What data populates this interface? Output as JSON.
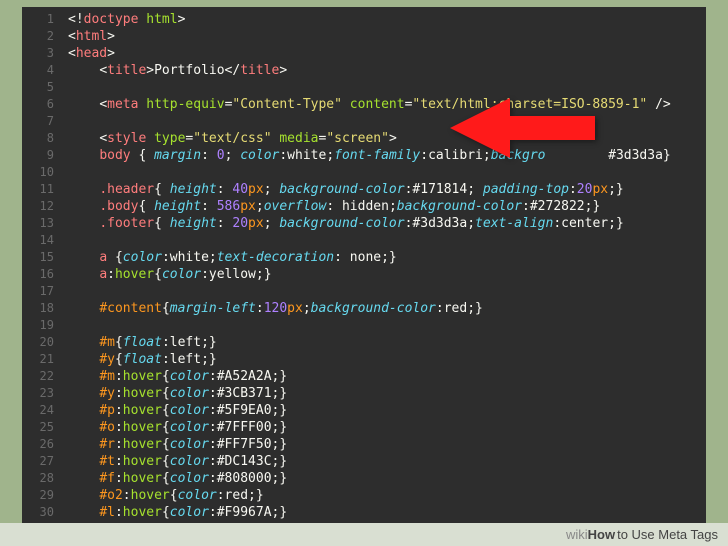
{
  "footer": {
    "wiki": "wiki",
    "how": "How",
    "title": " to Use Meta Tags"
  },
  "lines": [
    {
      "n": "1",
      "html": "<span class='w'>&lt;!</span><span class='t'>doctype</span> <span class='a'>html</span><span class='w'>&gt;</span>"
    },
    {
      "n": "2",
      "html": "<span class='w'>&lt;</span><span class='t'>html</span><span class='w'>&gt;</span>"
    },
    {
      "n": "3",
      "html": "<span class='w'>&lt;</span><span class='t'>head</span><span class='w'>&gt;</span>"
    },
    {
      "n": "4",
      "html": "    <span class='w'>&lt;</span><span class='t'>title</span><span class='w'>&gt;Portfolio&lt;/</span><span class='t'>title</span><span class='w'>&gt;</span>"
    },
    {
      "n": "5",
      "html": ""
    },
    {
      "n": "6",
      "html": "    <span class='w'>&lt;</span><span class='t'>meta</span> <span class='a'>http-equiv</span><span class='w'>=</span><span class='s'>\"Content-Type\"</span> <span class='a'>content</span><span class='w'>=</span><span class='s'>\"text/html;charset=ISO-8859-1\"</span> <span class='w'>/&gt;</span>",
      "hl": true
    },
    {
      "n": "7",
      "html": ""
    },
    {
      "n": "8",
      "html": "    <span class='w'>&lt;</span><span class='t'>style</span> <span class='a'>type</span><span class='w'>=</span><span class='s'>\"text/css\"</span> <span class='a'>media</span><span class='w'>=</span><span class='s'>\"screen\"</span><span class='w'>&gt;</span>"
    },
    {
      "n": "9",
      "html": "    <span class='t'>body</span> <span class='w'>{</span> <span class='k'>margin</span><span class='w'>:</span> <span class='n'>0</span><span class='w'>;</span> <span class='k'>color</span><span class='w'>:white;</span><span class='k'>font-family</span><span class='w'>:calibri;</span><span class='k'>backgro</span>        <span class='w'>#3d3d3a}</span>"
    },
    {
      "n": "10",
      "html": ""
    },
    {
      "n": "11",
      "html": "    <span class='t'>.header</span><span class='w'>{</span> <span class='k'>height</span><span class='w'>:</span> <span class='n'>40</span><span class='p'>px</span><span class='w'>;</span> <span class='k'>background-color</span><span class='w'>:#171814;</span> <span class='k'>padding-top</span><span class='w'>:</span><span class='n'>20</span><span class='p'>px</span><span class='w'>;}</span>"
    },
    {
      "n": "12",
      "html": "    <span class='t'>.body</span><span class='w'>{</span> <span class='k'>height</span><span class='w'>:</span> <span class='n'>586</span><span class='p'>px</span><span class='w'>;</span><span class='k'>overflow</span><span class='w'>:</span> <span class='w'>hidden;</span><span class='k'>background-color</span><span class='w'>:#272822;}</span>"
    },
    {
      "n": "13",
      "html": "    <span class='t'>.footer</span><span class='w'>{</span> <span class='k'>height</span><span class='w'>:</span> <span class='n'>20</span><span class='p'>px</span><span class='w'>;</span> <span class='k'>background-color</span><span class='w'>:#3d3d3a;</span><span class='k'>text-align</span><span class='w'>:center;}</span>"
    },
    {
      "n": "14",
      "html": ""
    },
    {
      "n": "15",
      "html": "    <span class='t'>a</span> <span class='w'>{</span><span class='k'>color</span><span class='w'>:white;</span><span class='k'>text-decoration</span><span class='w'>:</span> <span class='w'>none;}</span>"
    },
    {
      "n": "16",
      "html": "    <span class='t'>a</span><span class='w'>:</span><span class='a'>hover</span><span class='w'>{</span><span class='k'>color</span><span class='w'>:yellow;}</span>"
    },
    {
      "n": "17",
      "html": ""
    },
    {
      "n": "18",
      "html": "    <span class='p'>#content</span><span class='w'>{</span><span class='k'>margin-left</span><span class='w'>:</span><span class='n'>120</span><span class='p'>px</span><span class='w'>;</span><span class='k'>background-color</span><span class='w'>:red;}</span>"
    },
    {
      "n": "19",
      "html": ""
    },
    {
      "n": "20",
      "html": "    <span class='p'>#m</span><span class='w'>{</span><span class='k'>float</span><span class='w'>:left;}</span>"
    },
    {
      "n": "21",
      "html": "    <span class='p'>#y</span><span class='w'>{</span><span class='k'>float</span><span class='w'>:left;}</span>"
    },
    {
      "n": "22",
      "html": "    <span class='p'>#m</span><span class='w'>:</span><span class='a'>hover</span><span class='w'>{</span><span class='k'>color</span><span class='w'>:#A52A2A;}</span>"
    },
    {
      "n": "23",
      "html": "    <span class='p'>#y</span><span class='w'>:</span><span class='a'>hover</span><span class='w'>{</span><span class='k'>color</span><span class='w'>:#3CB371;}</span>"
    },
    {
      "n": "24",
      "html": "    <span class='p'>#p</span><span class='w'>:</span><span class='a'>hover</span><span class='w'>{</span><span class='k'>color</span><span class='w'>:#5F9EA0;}</span>"
    },
    {
      "n": "25",
      "html": "    <span class='p'>#o</span><span class='w'>:</span><span class='a'>hover</span><span class='w'>{</span><span class='k'>color</span><span class='w'>:#7FFF00;}</span>"
    },
    {
      "n": "26",
      "html": "    <span class='p'>#r</span><span class='w'>:</span><span class='a'>hover</span><span class='w'>{</span><span class='k'>color</span><span class='w'>:#FF7F50;}</span>"
    },
    {
      "n": "27",
      "html": "    <span class='p'>#t</span><span class='w'>:</span><span class='a'>hover</span><span class='w'>{</span><span class='k'>color</span><span class='w'>:#DC143C;}</span>"
    },
    {
      "n": "28",
      "html": "    <span class='p'>#f</span><span class='w'>:</span><span class='a'>hover</span><span class='w'>{</span><span class='k'>color</span><span class='w'>:#808000;}</span>"
    },
    {
      "n": "29",
      "html": "    <span class='p'>#o2</span><span class='w'>:</span><span class='a'>hover</span><span class='w'>{</span><span class='k'>color</span><span class='w'>:red;}</span>"
    },
    {
      "n": "30",
      "html": "    <span class='p'>#l</span><span class='w'>:</span><span class='a'>hover</span><span class='w'>{</span><span class='k'>color</span><span class='w'>:#F9967A;}</span>"
    }
  ]
}
